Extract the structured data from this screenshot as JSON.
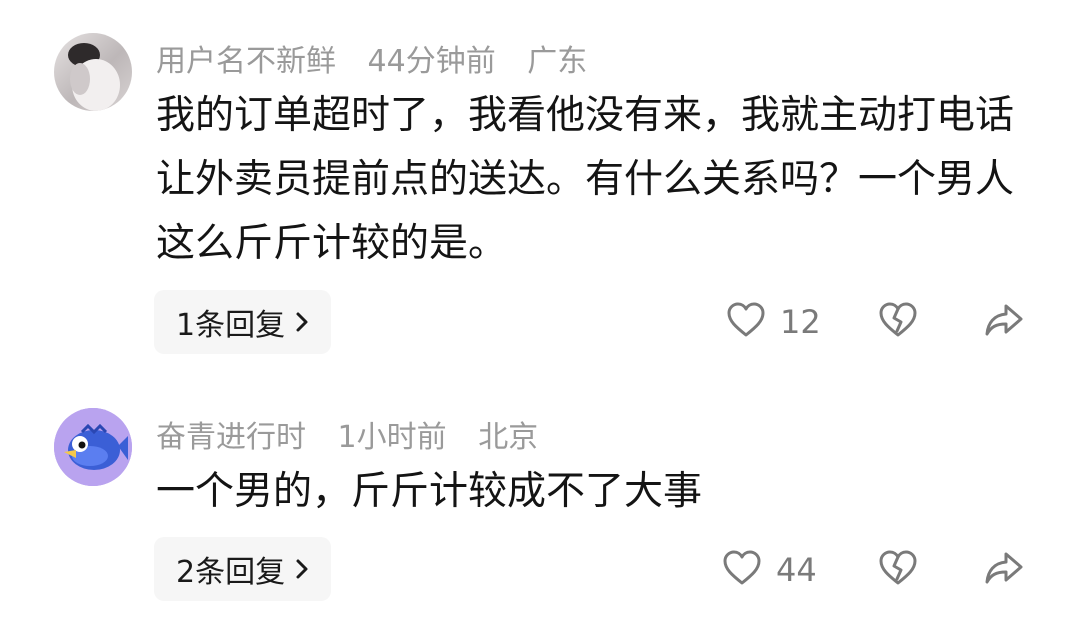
{
  "comments": [
    {
      "username": "用户名不新鲜",
      "time": "44分钟前",
      "location": "广东",
      "text": "我的订单超时了，我看他没有来，我就主动打电话让外卖员提前点的送达。有什么关系吗？一个男人这么斤斤计较的是。",
      "reply_label": "1条回复",
      "like_count": "12"
    },
    {
      "username": "奋青进行时",
      "time": "1小时前",
      "location": "北京",
      "text": "一个男的，斤斤计较成不了大事",
      "reply_label": "2条回复",
      "like_count": "44"
    }
  ],
  "icons": {
    "like": "heart-icon",
    "dislike": "broken-heart-icon",
    "share": "share-arrow-icon",
    "chevron": "chevron-right-icon"
  },
  "colors": {
    "meta_text": "#9a9a9a",
    "body_text": "#141414",
    "pill_bg": "#f6f6f6",
    "avatar2_bg": "#b9a3ef"
  }
}
